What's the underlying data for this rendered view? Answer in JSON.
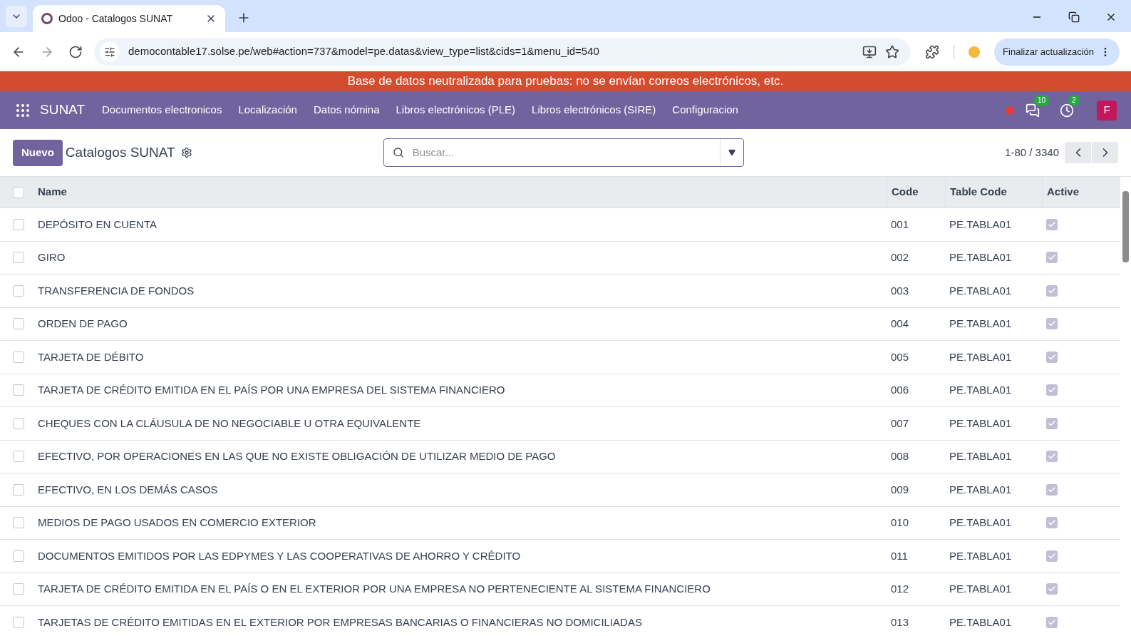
{
  "browser": {
    "tab": {
      "title": "Odoo - Catalogos SUNAT",
      "selected": true
    },
    "url": "democontable17.solse.pe/web#action=737&model=pe.datas&view_type=list&cids=1&menu_id=540",
    "update_button": "Finalizar actualización"
  },
  "banner": "Base de datos neutralizada para pruebas: no se envían correos electrónicos, etc.",
  "navbar": {
    "app": "SUNAT",
    "menus": [
      "Documentos electronicos",
      "Localización",
      "Datos nómina",
      "Libros electrónicos (PLE)",
      "Libros electrónicos (SIRE)",
      "Configuracion"
    ],
    "messages_badge": "10",
    "activities_badge": "2",
    "avatar": "F"
  },
  "control_panel": {
    "new_button": "Nuevo",
    "title": "Catalogos SUNAT",
    "search": {
      "placeholder": "Buscar..."
    },
    "pager": "1-80 / 3340"
  },
  "table": {
    "columns": [
      "Name",
      "Code",
      "Table Code",
      "Active"
    ],
    "all_checked": false,
    "rows": [
      {
        "name": "DEPÓSITO EN CUENTA",
        "code": "001",
        "table_code": "PE.TABLA01",
        "active": true,
        "checked": false
      },
      {
        "name": "GIRO",
        "code": "002",
        "table_code": "PE.TABLA01",
        "active": true,
        "checked": false
      },
      {
        "name": "TRANSFERENCIA DE FONDOS",
        "code": "003",
        "table_code": "PE.TABLA01",
        "active": true,
        "checked": false
      },
      {
        "name": "ORDEN DE PAGO",
        "code": "004",
        "table_code": "PE.TABLA01",
        "active": true,
        "checked": false
      },
      {
        "name": "TARJETA DE DÉBITO",
        "code": "005",
        "table_code": "PE.TABLA01",
        "active": true,
        "checked": false
      },
      {
        "name": "TARJETA DE CRÉDITO EMITIDA EN EL PAÍS POR UNA EMPRESA DEL SISTEMA FINANCIERO",
        "code": "006",
        "table_code": "PE.TABLA01",
        "active": true,
        "checked": false
      },
      {
        "name": "CHEQUES CON LA CLÁUSULA DE NO NEGOCIABLE U OTRA EQUIVALENTE",
        "code": "007",
        "table_code": "PE.TABLA01",
        "active": true,
        "checked": false
      },
      {
        "name": "EFECTIVO, POR OPERACIONES EN LAS QUE NO EXISTE OBLIGACIÓN DE UTILIZAR MEDIO DE PAGO",
        "code": "008",
        "table_code": "PE.TABLA01",
        "active": true,
        "checked": false
      },
      {
        "name": "EFECTIVO, EN LOS DEMÁS CASOS",
        "code": "009",
        "table_code": "PE.TABLA01",
        "active": true,
        "checked": false
      },
      {
        "name": "MEDIOS DE PAGO USADOS EN COMERCIO EXTERIOR",
        "code": "010",
        "table_code": "PE.TABLA01",
        "active": true,
        "checked": false
      },
      {
        "name": "DOCUMENTOS EMITIDOS POR LAS EDPYMES Y LAS COOPERATIVAS DE AHORRO Y CRÉDITO",
        "code": "011",
        "table_code": "PE.TABLA01",
        "active": true,
        "checked": false
      },
      {
        "name": "TARJETA DE CRÉDITO EMITIDA EN EL PAÍS O EN EL EXTERIOR POR UNA EMPRESA NO PERTENECIENTE AL SISTEMA FINANCIERO",
        "code": "012",
        "table_code": "PE.TABLA01",
        "active": true,
        "checked": false
      },
      {
        "name": "TARJETAS DE CRÉDITO EMITIDAS EN EL EXTERIOR POR EMPRESAS BANCARIAS O FINANCIERAS NO DOMICILIADAS",
        "code": "013",
        "table_code": "PE.TABLA01",
        "active": true,
        "checked": false
      }
    ]
  }
}
